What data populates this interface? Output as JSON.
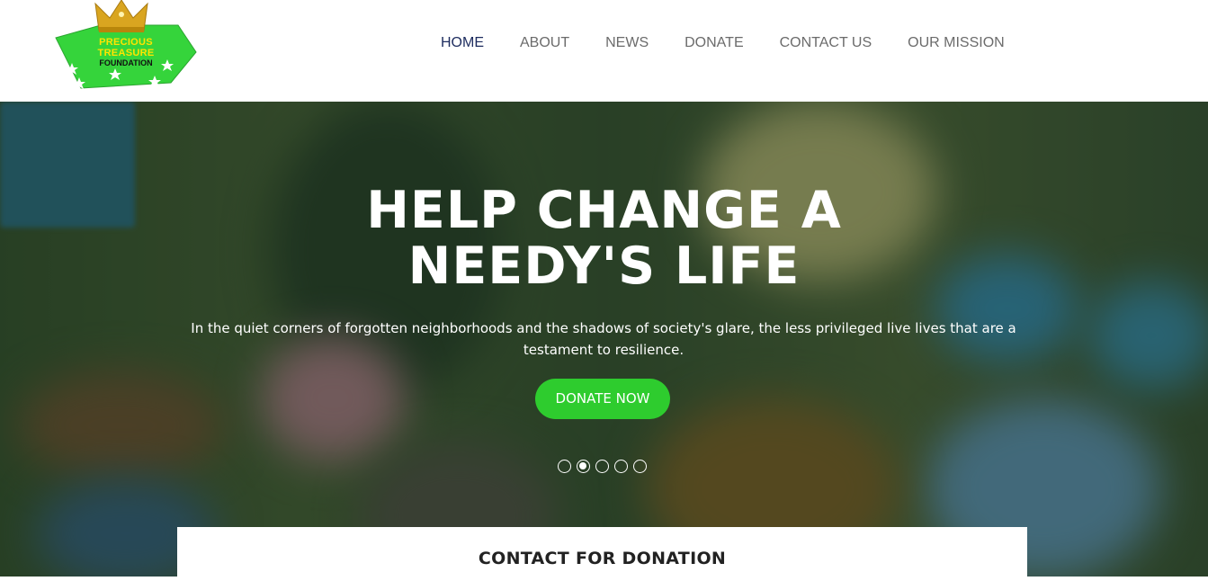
{
  "logo": {
    "line1": "PRECIOUS",
    "line2": "TREASURE",
    "line3": "FOUNDATION",
    "icon": "crown-icon",
    "colors": {
      "badge": "#35d43b",
      "crown": "#d9a520",
      "text": "#ffe400"
    }
  },
  "nav": {
    "items": [
      {
        "label": "HOME",
        "active": true
      },
      {
        "label": "ABOUT",
        "active": false
      },
      {
        "label": "NEWS",
        "active": false
      },
      {
        "label": "DONATE",
        "active": false
      },
      {
        "label": "CONTACT US",
        "active": false
      },
      {
        "label": "OUR MISSION",
        "active": false
      }
    ]
  },
  "hero": {
    "title_line1": "HELP CHANGE A",
    "title_line2": "NEEDY'S LIFE",
    "text": "In the quiet corners of forgotten neighborhoods and the shadows of society's glare, the less privileged live lives that are a testament to resilience.",
    "button_label": "DONATE NOW",
    "slides_total": 5,
    "active_slide": 2,
    "colors": {
      "button": "#2ecc2e",
      "overlay": "#12341a"
    }
  },
  "contact": {
    "title": "CONTACT FOR DONATION"
  }
}
